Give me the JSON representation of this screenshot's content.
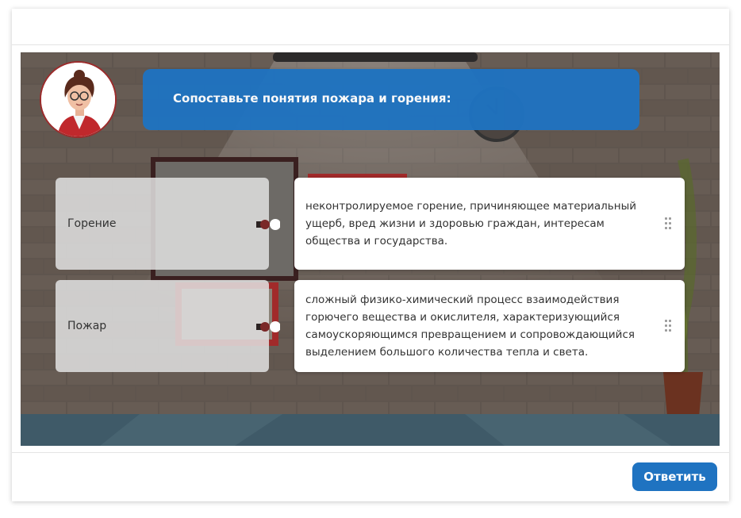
{
  "banner": {
    "text": "Сопоставьте понятия пожара и горения:"
  },
  "pairs": [
    {
      "term": "Горение",
      "definition": "неконтролируемое горение, причиняющее материальный ущерб, вред жизни и здоровью граждан, интересам общества и государства."
    },
    {
      "term": "Пожар",
      "definition": "сложный физико-химический процесс взаимодействия горючего вещества и окислителя, характеризующийся самоускоряющимся превращением и сопровождающийся выделением большого количества тепла и света."
    }
  ],
  "footer": {
    "answer_label": "Ответить"
  },
  "colors": {
    "accent": "#1f73c1",
    "wall": "#5e544d",
    "floor": "#3f5a68"
  },
  "icons": {
    "drag": "drag-handle-icon",
    "avatar": "presenter-avatar",
    "connector": "puzzle-connector-icon"
  }
}
